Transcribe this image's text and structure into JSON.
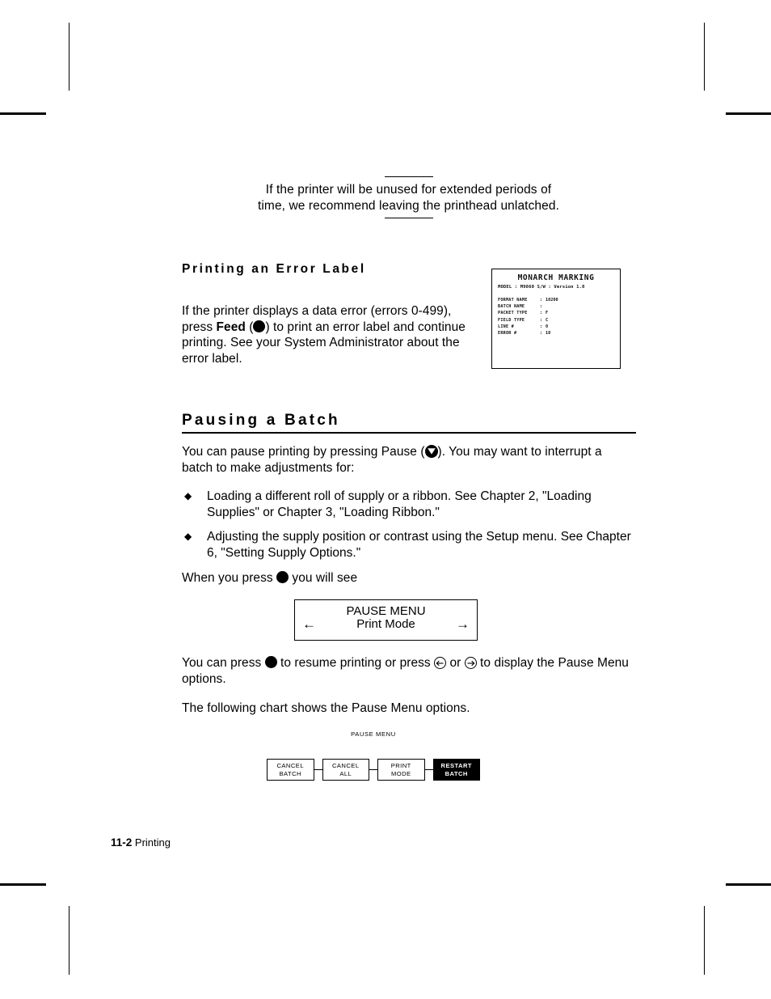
{
  "document": {
    "footer": {
      "page_number": "11-2",
      "chapter_name": "Printing"
    }
  },
  "note": {
    "text": "If the printer will be unused for extended periods of time, we recommend leaving the printhead unlatched."
  },
  "sections": {
    "error_label": {
      "heading": "Printing an Error Label",
      "paragraph_part1": "If the printer displays a data error (errors 0-499), press ",
      "paragraph_bold": "Feed",
      "paragraph_part2": " (",
      "paragraph_part3": ") to print an error label and continue printing.  See your System Administrator about the error label."
    },
    "pausing_a_batch": {
      "heading": "Pausing a Batch",
      "intro_part1": "You can pause printing by pressing Pause (",
      "intro_part2": ").  You may want to interrupt a batch to make adjustments for:",
      "bullets": [
        {
          "marker": "◆",
          "text": "Loading a different roll of supply or a ribbon.  See Chapter 2, \"Loading Supplies\" or Chapter 3, \"Loading Ribbon.\""
        },
        {
          "marker": "◆",
          "text": "Adjusting the supply position or contrast using the Setup menu.  See Chapter 6, \"Setting Supply Options.\""
        }
      ],
      "when_press_part1": "When you press ",
      "when_press_part2": " you will see",
      "resume_part1": "You can press ",
      "resume_part2": " to resume printing or press ",
      "resume_part3": " or ",
      "resume_part4": " to display the Pause Menu options.",
      "following_chart": "The following chart shows the Pause Menu options."
    }
  },
  "error_label_graphic": {
    "title": "MONARCH MARKING",
    "model_line": "MODEL : M9860 S/W :   Version 1.0",
    "fields": [
      {
        "key": "FORMAT NAME",
        "colon": ":",
        "value": "10200"
      },
      {
        "key": "BATCH NAME",
        "colon": ":",
        "value": ""
      },
      {
        "key": "PACKET TYPE",
        "colon": ":",
        "value": "F"
      },
      {
        "key": "FIELD TYPE",
        "colon": ":",
        "value": "C"
      },
      {
        "key": "LINE #",
        "colon": ":",
        "value": "0"
      },
      {
        "key": "ERROR #",
        "colon": ":",
        "value": "10"
      }
    ]
  },
  "display_panel": {
    "title": "PAUSE MENU",
    "left_arrow": "←",
    "mode": "Print Mode",
    "right_arrow": "→"
  },
  "pause_menu_chart": {
    "title": "PAUSE MENU",
    "options": [
      {
        "line1": "CANCEL",
        "line2": "BATCH",
        "selected": false
      },
      {
        "line1": "CANCEL",
        "line2": "ALL",
        "selected": false
      },
      {
        "line1": "PRINT",
        "line2": "MODE",
        "selected": false
      },
      {
        "line1": "RESTART",
        "line2": "BATCH",
        "selected": true
      }
    ]
  },
  "icons": {
    "feed_key": "feed-key-icon",
    "pause_key": "pause-key-icon",
    "left_arrow_key": "left-arrow-key-icon",
    "right_arrow_key": "right-arrow-key-icon",
    "bullet": "diamond-bullet-icon"
  },
  "colors": {
    "ink": "#000000",
    "paper": "#ffffff"
  }
}
